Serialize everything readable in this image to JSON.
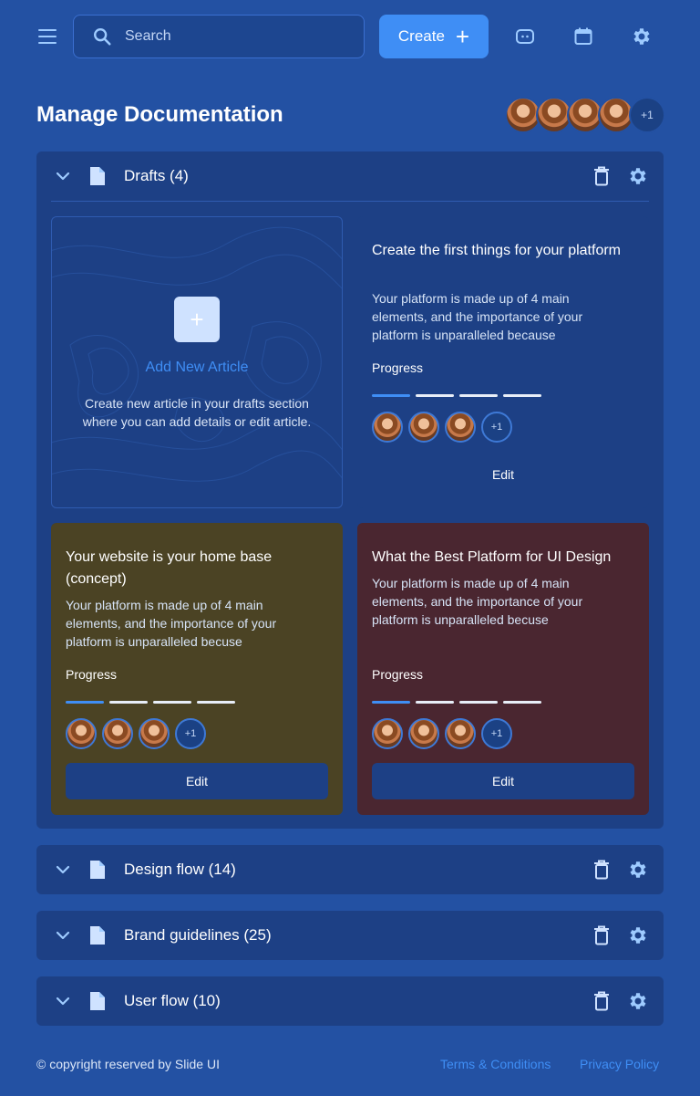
{
  "search": {
    "placeholder": "Search"
  },
  "create_button": {
    "label": "Create",
    "icon": "plus-icon"
  },
  "top_icons": [
    "menu-icon",
    "search-icon",
    "chat-icon",
    "calendar-icon",
    "gear-icon"
  ],
  "page": {
    "title": "Manage Documentation",
    "team_more": "+1"
  },
  "sections": [
    {
      "title": "Drafts (4)",
      "expanded": true
    },
    {
      "title": "Design flow (14)",
      "expanded": false
    },
    {
      "title": "Brand guidelines (25)",
      "expanded": false
    },
    {
      "title": "User flow (10)",
      "expanded": false
    }
  ],
  "add_article": {
    "plus": "+",
    "title": "Add New Article",
    "description": "Create new article in your drafts section where you can add details or edit article."
  },
  "cards": [
    {
      "title": "Create the first things for your platform",
      "description": "Your platform is made up of 4 main elements, and the importance of your platform is unparalleled because",
      "progress_label": "Progress",
      "progress_steps_done": 1,
      "progress_steps_total": 4,
      "team_more": "+1",
      "edit_label": "Edit",
      "background": "#1d4085"
    },
    {
      "title": "Your website is your home base (concept)",
      "description": "Your platform is made up of 4 main elements, and the importance of your platform is unparalleled becuse",
      "progress_label": "Progress",
      "progress_steps_done": 1,
      "progress_steps_total": 4,
      "team_more": "+1",
      "edit_label": "Edit",
      "background": "#4b4324"
    },
    {
      "title": "What the Best Platform for UI Design",
      "description": "Your platform is made up of 4 main elements, and the importance of your platform is unparalleled becuse",
      "progress_label": "Progress",
      "progress_steps_done": 1,
      "progress_steps_total": 4,
      "team_more": "+1",
      "edit_label": "Edit",
      "background": "#4a2630"
    }
  ],
  "footer": {
    "copyright": "© copyright reserved by Slide UI",
    "terms": "Terms & Conditions",
    "privacy": "Privacy Policy"
  },
  "colors": {
    "background": "#2351a3",
    "panel": "#1d4085",
    "accent": "#3f8ef5",
    "icon": "#9ecbff"
  }
}
